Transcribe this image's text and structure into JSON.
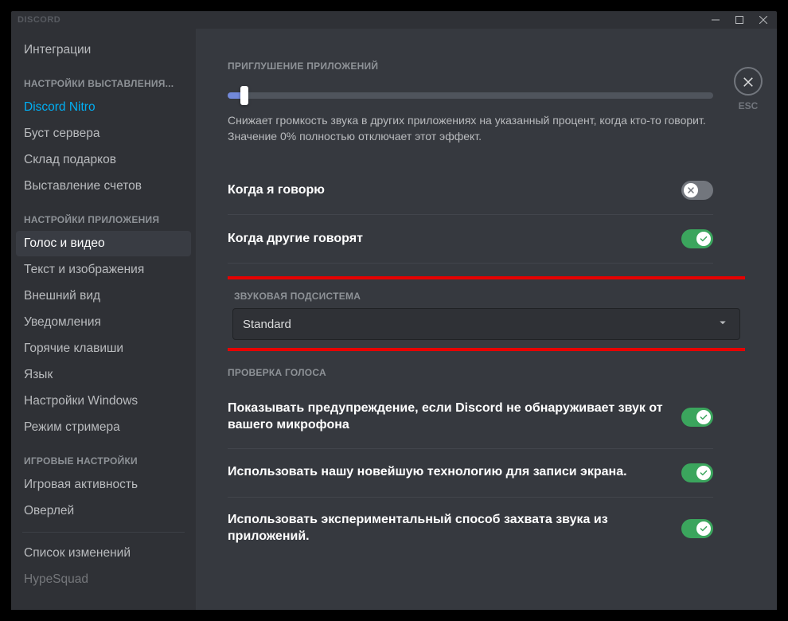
{
  "app": {
    "name": "DISCORD"
  },
  "close": {
    "label": "ESC"
  },
  "sidebar": {
    "top_item": "Интеграции",
    "billing_header": "НАСТРОЙКИ ВЫСТАВЛЕНИЯ...",
    "billing": [
      "Discord Nitro",
      "Буст сервера",
      "Склад подарков",
      "Выставление счетов"
    ],
    "app_header": "НАСТРОЙКИ ПРИЛОЖЕНИЯ",
    "app_items": [
      "Голос и видео",
      "Текст и изображения",
      "Внешний вид",
      "Уведомления",
      "Горячие клавиши",
      "Язык",
      "Настройки Windows",
      "Режим стримера"
    ],
    "game_header": "ИГРОВЫЕ НАСТРОЙКИ",
    "game_items": [
      "Игровая активность",
      "Оверлей"
    ],
    "bottom_items": [
      "Список изменений",
      "HypeSquad"
    ]
  },
  "content": {
    "attenuation_header": "ПРИГЛУШЕНИЕ ПРИЛОЖЕНИЙ",
    "attenuation_desc": "Снижает громкость звука в других приложениях на указанный процент, когда кто-то говорит. Значение 0% полностью отключает этот эффект.",
    "when_i_speak": "Когда я говорю",
    "when_others_speak": "Когда другие говорят",
    "audio_subsystem_header": "ЗВУКОВАЯ ПОДСИСТЕМА",
    "audio_subsystem_value": "Standard",
    "voice_check_header": "ПРОВЕРКА ГОЛОСА",
    "voice_warning": "Показывать предупреждение, если Discord не обнаруживает звук от вашего микрофона",
    "screen_tech": "Использовать нашу новейшую технологию для записи экрана.",
    "experimental_capture": "Использовать экспериментальный способ захвата звука из приложений."
  }
}
